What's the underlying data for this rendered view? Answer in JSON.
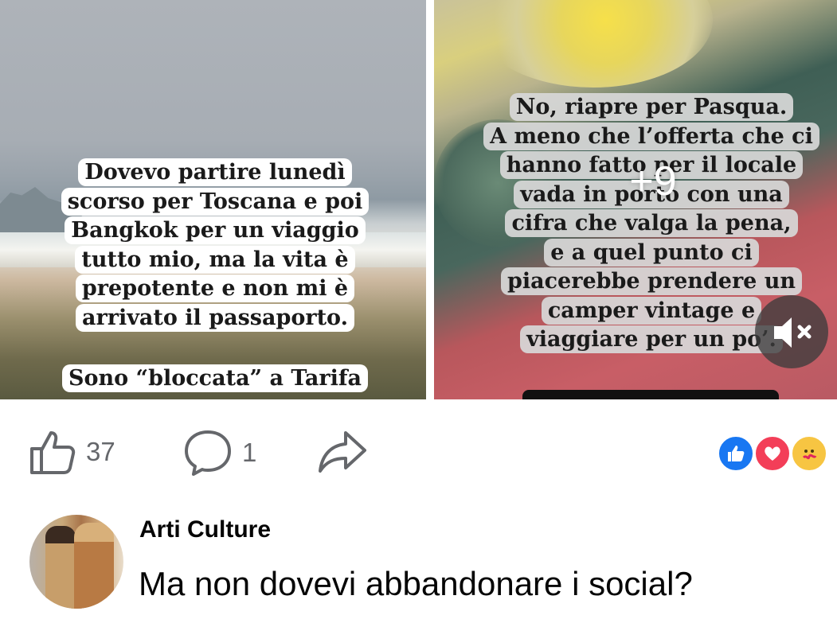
{
  "post": {
    "media": {
      "left": {
        "lines": [
          "Dovevo partire lunedì",
          "scorso per Toscana e poi",
          "Bangkok per un viaggio",
          "tutto mio, ma la vita è",
          "prepotente e non mi è",
          "arrivato il passaporto."
        ],
        "second_lines": [
          "Sono “bloccata” a Tarifa"
        ]
      },
      "right": {
        "lines": [
          "No, riapre per Pasqua.",
          "A meno che l’offerta che ci",
          "hanno fatto per il locale",
          "vada in porto con una",
          "cifra che valga la pena,",
          "e a quel punto ci",
          "piacerebbe prendere un",
          "camper vintage e",
          "viaggiare per un po’."
        ],
        "more_count": "+9",
        "mute_icon": "speaker-muted-icon"
      }
    },
    "actions": {
      "like_count": "37",
      "comment_count": "1",
      "like_icon": "thumbs-up-icon",
      "comment_icon": "speech-bubble-icon",
      "share_icon": "share-arrow-icon"
    },
    "reactions": [
      {
        "name": "like",
        "color": "#1877f2"
      },
      {
        "name": "love",
        "color": "#f33e58"
      },
      {
        "name": "care",
        "color": "#f7c542"
      }
    ]
  },
  "comment": {
    "author": "Arti Culture",
    "text": "Ma non dovevi abbandonare i social?"
  }
}
